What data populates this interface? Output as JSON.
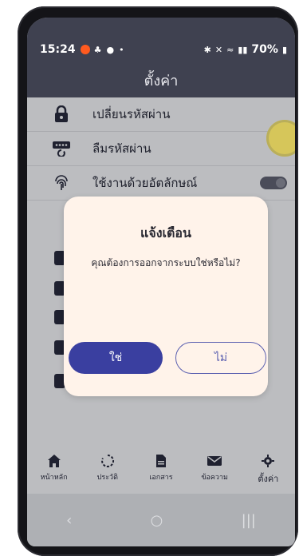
{
  "status_bar": {
    "time": "15:24",
    "battery": "70%"
  },
  "header": {
    "title": "ตั้งค่า"
  },
  "settings": {
    "items": [
      {
        "label": "เปลี่ยนรหัสผ่าน"
      },
      {
        "label": "ลืมรหัสผ่าน"
      },
      {
        "label": "ใช้งานด้วยอัตลักษณ์"
      }
    ]
  },
  "dialog": {
    "title": "แจ้งเตือน",
    "message": "คุณต้องการออกจากระบบใช่หรือไม่?",
    "yes_label": "ใช่",
    "no_label": "ไม่"
  },
  "bottom_nav": [
    {
      "label": "หน้าหลัก"
    },
    {
      "label": "ประวัติ"
    },
    {
      "label": "เอกสาร"
    },
    {
      "label": "ข้อความ"
    },
    {
      "label": "ตั้งค่า"
    }
  ],
  "colors": {
    "header_bg": "#3f4150",
    "primary": "#3a3fa0",
    "dialog_bg": "#fff3ea"
  }
}
